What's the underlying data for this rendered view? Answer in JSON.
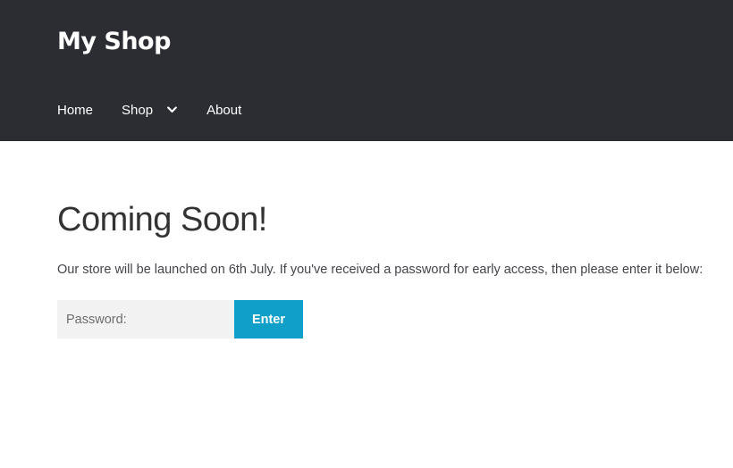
{
  "header": {
    "site_title": "My Shop",
    "nav": [
      {
        "label": "Home"
      },
      {
        "label": "Shop",
        "has_dropdown": true,
        "icon": "chevron-down-icon"
      },
      {
        "label": "About"
      }
    ]
  },
  "main": {
    "title": "Coming Soon!",
    "intro": "Our store will be launched on 6th July. If you've received a password for early access, then please enter it below:",
    "form": {
      "password_placeholder": "Password:",
      "password_value": "",
      "submit_label": "Enter"
    }
  },
  "colors": {
    "header_bg": "#2c2d33",
    "accent": "#0f9fc9",
    "input_bg": "#f2f2f2"
  }
}
